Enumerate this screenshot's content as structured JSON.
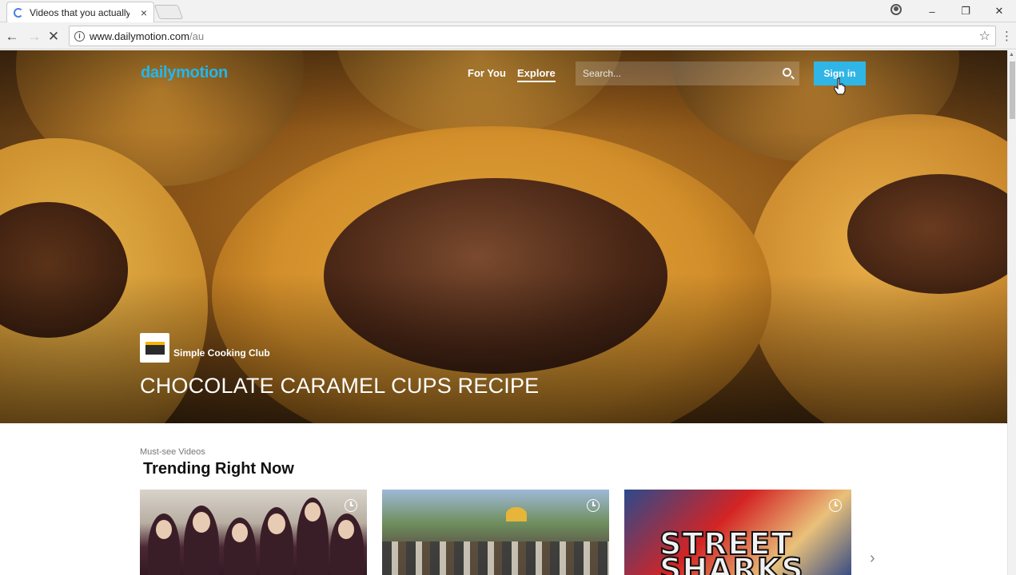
{
  "browser": {
    "tab_title": "Videos that you actually",
    "tab_close": "×",
    "url_host": "www.dailymotion.com",
    "url_path": "/au",
    "window_controls": [
      "–",
      "❐",
      "✕"
    ],
    "nav_icons": [
      "back-icon",
      "forward-icon",
      "stop-icon"
    ]
  },
  "header": {
    "logo": "dailymotion",
    "nav": [
      {
        "label": "For You",
        "active": false
      },
      {
        "label": "Explore",
        "active": true
      }
    ],
    "search_placeholder": "Search...",
    "signin_label": "Sign in"
  },
  "hero": {
    "channel": "Simple Cooking Club",
    "title": "CHOCOLATE CARAMEL CUPS RECIPE"
  },
  "trending": {
    "kicker": "Must-see Videos",
    "title": "Trending Right Now",
    "thumbnails": [
      {
        "name": "group-portrait"
      },
      {
        "name": "street-crowd"
      },
      {
        "name": "street-sharks-cartoon",
        "text": "STREET SHARKS"
      }
    ],
    "next_arrow": "›"
  },
  "colors": {
    "brand": "#1fb9ee",
    "signin_bg": "#2fb6e6"
  }
}
